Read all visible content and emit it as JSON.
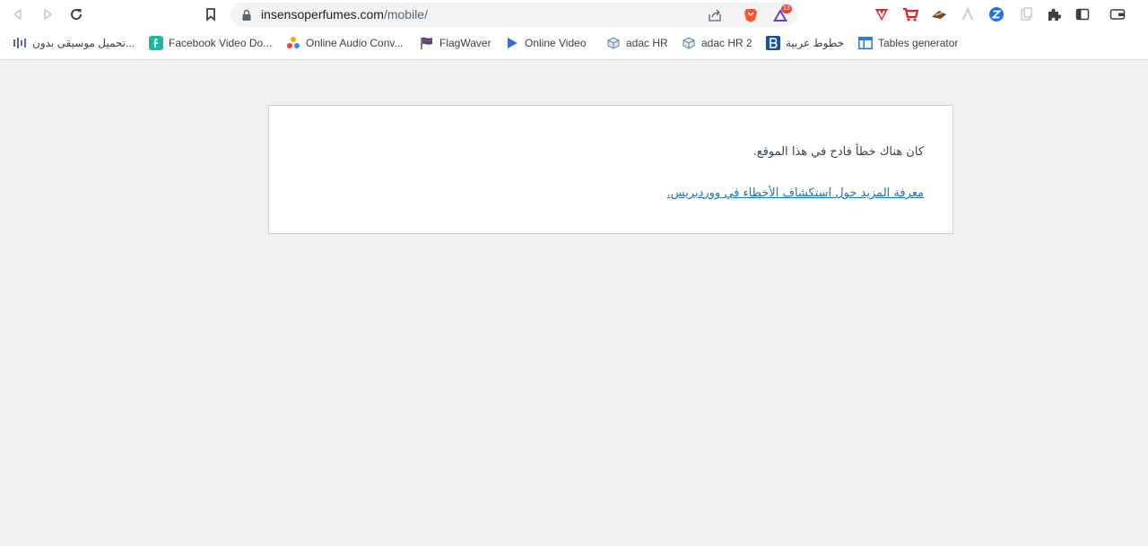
{
  "browser": {
    "url_host": "insensoperfumes.com",
    "url_path": "/mobile/",
    "brave_badge_count": "13",
    "bookmarks": [
      {
        "label": "تحميل موسيقى بدون...",
        "icon": "music-bars-icon"
      },
      {
        "label": "Facebook Video Do...",
        "icon": "facebook-video-icon"
      },
      {
        "label": "Online Audio Conv...",
        "icon": "audio-converter-icon"
      },
      {
        "label": "FlagWaver",
        "icon": "flag-icon"
      },
      {
        "label": "Online Video",
        "icon": "play-icon"
      },
      {
        "label": "adac HR",
        "icon": "cube-icon"
      },
      {
        "label": "adac HR 2",
        "icon": "cube-icon"
      },
      {
        "label": "خطوط عربية",
        "icon": "b-logo-icon"
      },
      {
        "label": "Tables generator",
        "icon": "table-icon"
      }
    ]
  },
  "page": {
    "error_message": "كان هناك خطأ فادح في هذا الموقع.",
    "learn_more_link": "معرفة المزيد حول استكشاف الأخطاء في ووردبريس."
  },
  "colors": {
    "page_background": "#f1f1f1",
    "link": "#2271b1",
    "text": "#3c434a"
  }
}
